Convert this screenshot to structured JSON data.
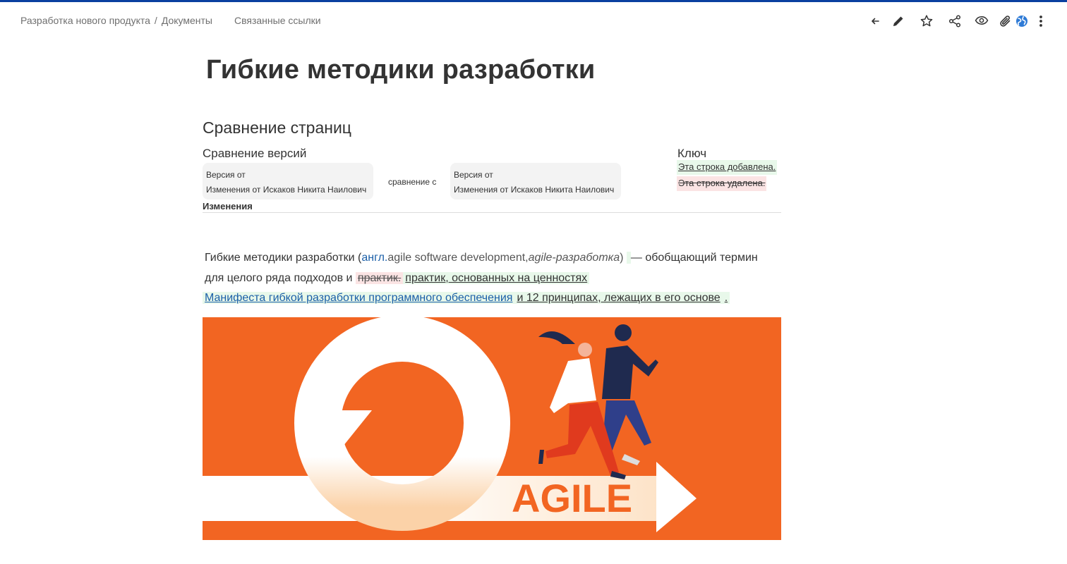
{
  "breadcrumb": {
    "items": [
      "Разработка нового продукта",
      "Документы"
    ],
    "separator": "/"
  },
  "header": {
    "related_links": "Связанные ссылки",
    "icons": [
      "back-arrow-icon",
      "pencil-icon",
      "star-icon",
      "share-icon",
      "eye-icon",
      "paperclip-icon",
      "globe-icon",
      "more-vertical-icon"
    ]
  },
  "page": {
    "title": "Гибкие методики разработки"
  },
  "compare": {
    "section_title": "Сравнение страниц",
    "versions_label": "Сравнение версий",
    "left_version": {
      "line1": "Версия от",
      "line2": "Изменения от Искаков Никита Наилович"
    },
    "compare_with": "сравнение с",
    "right_version": {
      "line1": "Версия от",
      "line2": "Изменения от Искаков Никита Наилович"
    },
    "key_label": "Ключ",
    "key_added": "Эта строка добавлена.",
    "key_removed": "Эта строка удалена.",
    "changes_label": "Изменения"
  },
  "diff": {
    "p1_a": "Гибкие методики разработки (",
    "p1_link": "англ.",
    "p1_b": "agile software development,",
    "p1_italic": "agile-разработка",
    "p1_c": ") ",
    "p1_ins_space": " ",
    "p1_d": " — обобщающий термин",
    "p2_a": "для целого ряда подходов и ",
    "p2_del": "практик.",
    "p2_ins": "практик, основанных на ценностях",
    "p3_ins_link": "Манифеста гибкой разработки программного обеспечения",
    "p3_ins_text": "и 12 принципах, лежащих в его основе",
    "p3_ins_dot": "."
  },
  "image": {
    "text": "AGILE"
  },
  "colors": {
    "accent_bar": "#0a3fa0",
    "image_bg": "#f26522",
    "added_bg": "#e8f8ea",
    "removed_bg": "#fbe4e4",
    "link": "#1b5fa8"
  }
}
